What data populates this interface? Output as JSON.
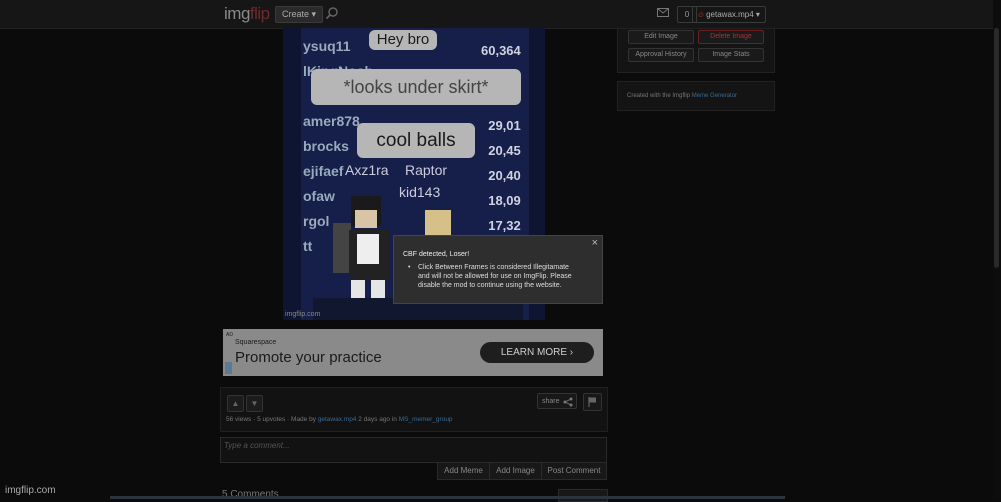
{
  "header": {
    "logo_prefix": "img",
    "logo_suffix": "flip",
    "create_label": "Create ▾",
    "notif_count": "0",
    "username": "getawax.mp4 ▾"
  },
  "meme": {
    "bubbles": [
      "Hey bro",
      "*looks under skirt*",
      "cool balls"
    ],
    "left_names": [
      "ysuq11",
      "lKingNoah",
      "amer878",
      "brocks",
      "ejifaef",
      "ofaw",
      "rgol",
      "tt"
    ],
    "right_scores": [
      "60,364",
      "29,01",
      "20,45",
      "20,40",
      "18,09",
      "17,32"
    ],
    "avatar_names": [
      "Axz1ra",
      "Raptor",
      "kid143"
    ],
    "watermark": "imgflip.com"
  },
  "sidebar": {
    "buttons": [
      "Edit Image",
      "Delete Image",
      "Approval History",
      "Image Stats"
    ],
    "created_prefix": "Created with the Imgflip ",
    "created_link": "Meme Generator"
  },
  "modal": {
    "title": "CBF detected, Loser!",
    "bullet": "Click Between Frames is considered Illegitamate and will not be allowed for use on ImgFlip. Please disable the mod to continue using the website.",
    "close": "×"
  },
  "ad": {
    "badge": "AD",
    "brand": "Squarespace",
    "headline": "Promote your practice",
    "cta": "LEARN MORE"
  },
  "actions": {
    "share": "share",
    "meta_prefix": "56 views · 5 upvotes · Made by ",
    "author": "getawax.mp4",
    "meta_mid": " 2 days ago in ",
    "stream": "MS_memer_group"
  },
  "comment": {
    "placeholder": "Type a comment...",
    "add_meme": "Add Meme",
    "add_image": "Add Image",
    "post": "Post Comment"
  },
  "comments_header": "5 Comments",
  "footer_watermark": "imgflip.com"
}
